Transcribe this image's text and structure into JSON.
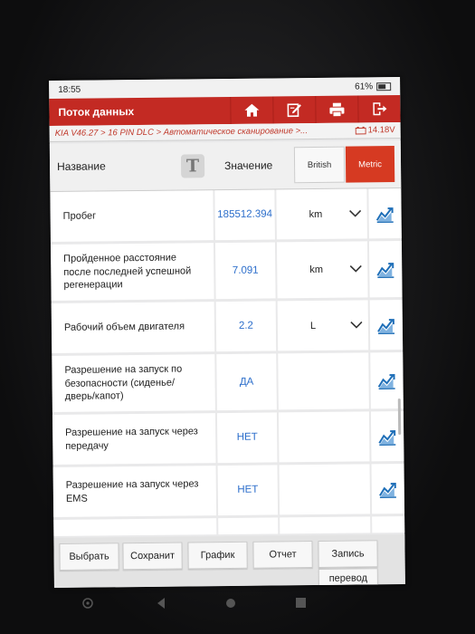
{
  "status": {
    "time": "18:55",
    "battery": "61%"
  },
  "appbar": {
    "title": "Поток данных",
    "icons": [
      "home-icon",
      "edit-icon",
      "print-icon",
      "exit-icon"
    ]
  },
  "breadcrumb": {
    "path": "KIA V46.27 > 16 PIN DLC > Автоматическое сканирование >...",
    "voltage": "14.18V"
  },
  "header": {
    "name_label": "Название",
    "text_icon": "T",
    "value_label": "Значение",
    "unit_british": "British",
    "unit_metric": "Metric"
  },
  "rows": [
    {
      "name": "Пробег",
      "value": "185512.394",
      "unit": "km",
      "dropdown": true
    },
    {
      "name": "Пройденное расстояние после последней успешной регенерации",
      "value": "7.091",
      "unit": "km",
      "dropdown": true
    },
    {
      "name": "Рабочий объем двигателя",
      "value": "2.2",
      "unit": "L",
      "dropdown": true
    },
    {
      "name": "Разрешение на запуск по безопасности (сиденье/дверь/капот)",
      "value": "ДА",
      "unit": "",
      "dropdown": false
    },
    {
      "name": "Разрешение на запуск через передачу",
      "value": "НЕТ",
      "unit": "",
      "dropdown": false
    },
    {
      "name": "Разрешение на запуск через EMS",
      "value": "НЕТ",
      "unit": "",
      "dropdown": false
    }
  ],
  "buttons": {
    "select": "Выбрать",
    "save": "Сохранит",
    "graph": "График",
    "report": "Отчет",
    "record": "Запись",
    "translate": "перевод"
  },
  "colors": {
    "accent": "#c32a23",
    "metric_active": "#d63a22",
    "value_text": "#2c6ecb"
  }
}
